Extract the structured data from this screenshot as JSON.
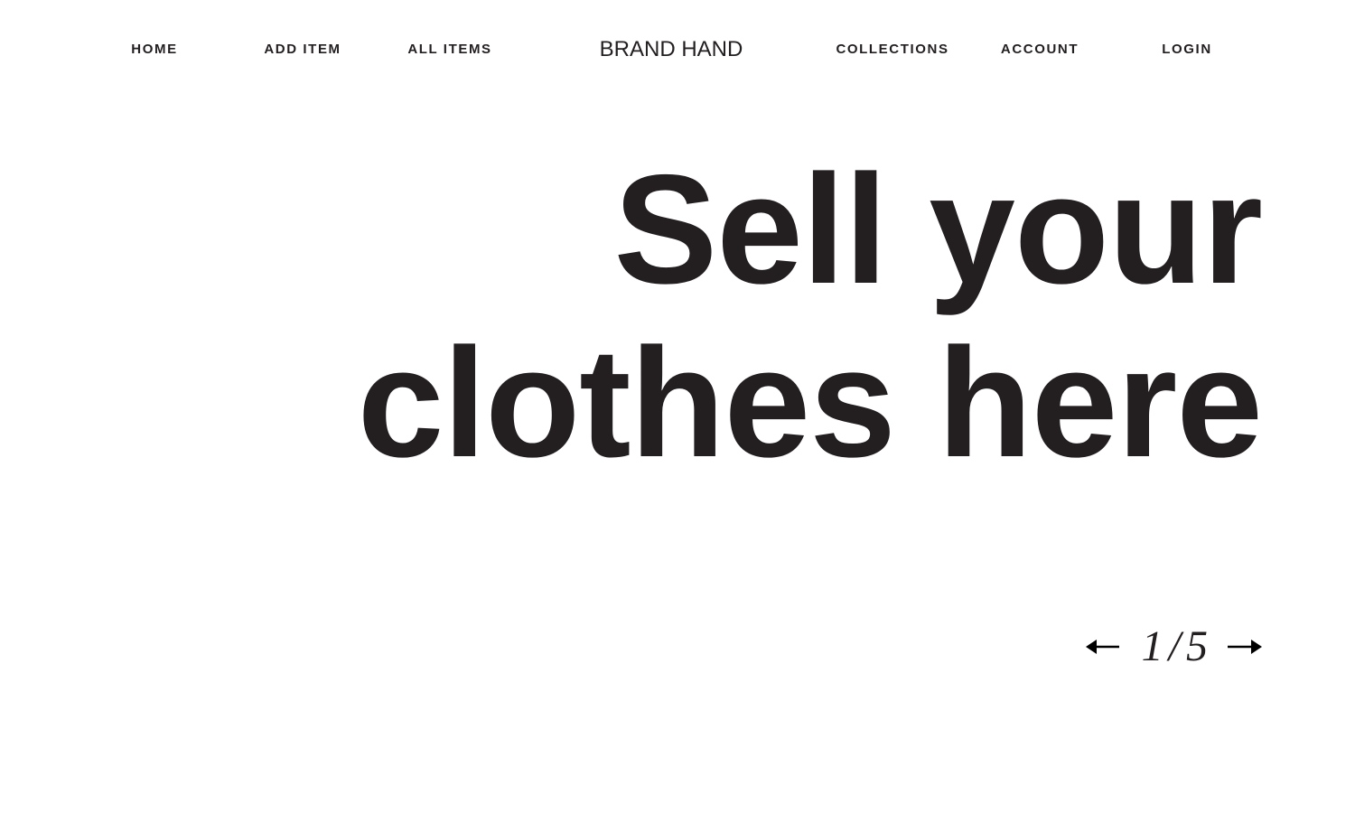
{
  "nav": {
    "left": [
      {
        "label": "HOME"
      },
      {
        "label": "ADD ITEM"
      },
      {
        "label": "ALL ITEMS"
      }
    ],
    "brand": "BRAND HAND",
    "right": [
      {
        "label": "COLLECTIONS"
      },
      {
        "label": "ACCOUNT"
      },
      {
        "label": "LOGIN"
      }
    ]
  },
  "hero": {
    "line1": "Sell your",
    "line2": "clothes here"
  },
  "pager": {
    "current": "1",
    "separator": "/",
    "total": "5",
    "prev_icon": "arrow-left-icon",
    "next_icon": "arrow-right-icon"
  },
  "colors": {
    "text": "#231f20",
    "background": "#ffffff"
  }
}
